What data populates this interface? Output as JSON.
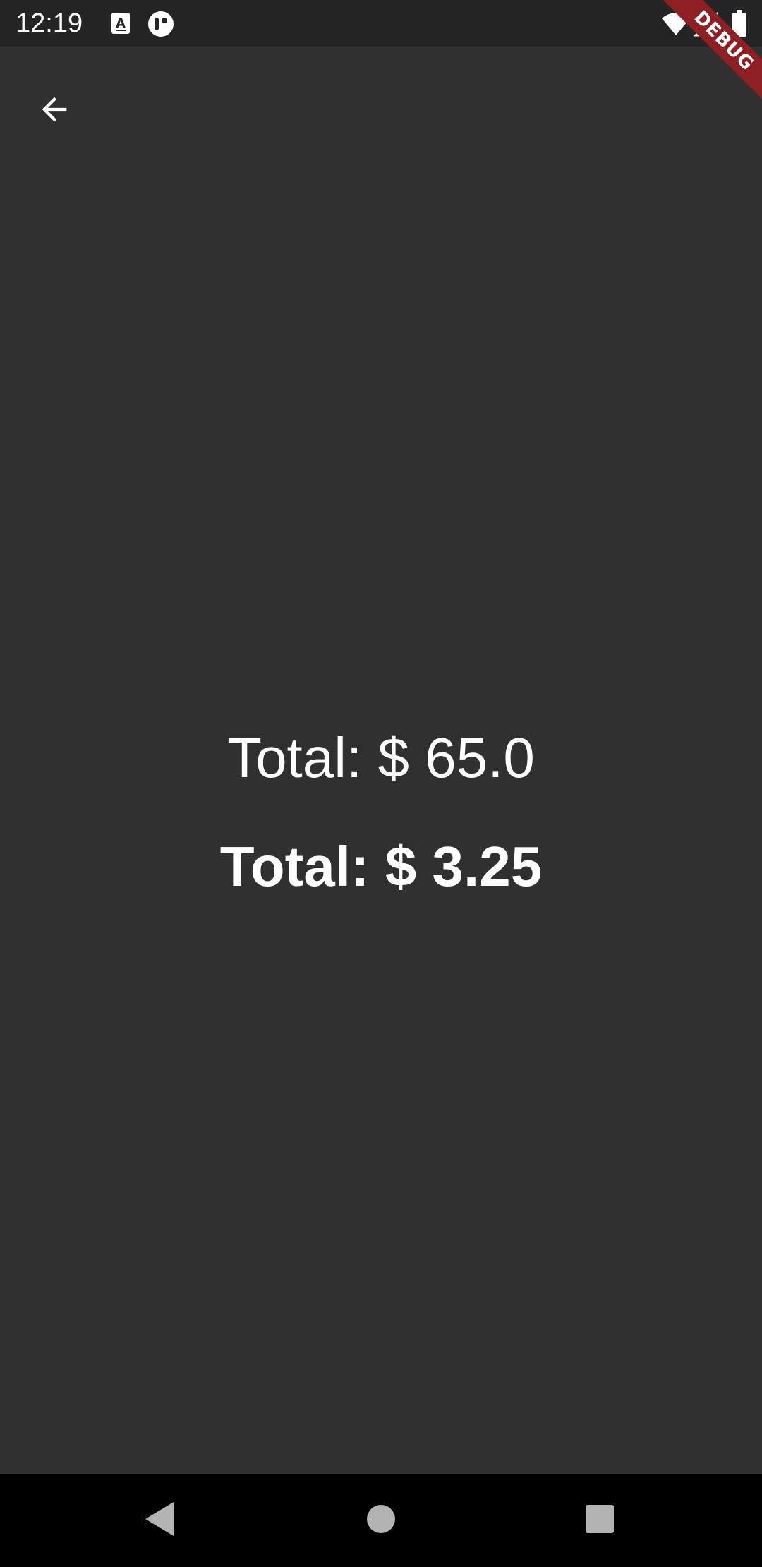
{
  "status_bar": {
    "time": "12:19",
    "icons": [
      "text-recognition-icon",
      "app-notification-icon",
      "wifi-icon",
      "cellular-signal-icon",
      "battery-icon"
    ]
  },
  "app_bar": {
    "back_icon": "arrow-back-icon"
  },
  "content": {
    "total_regular": "Total: $ 65.0",
    "total_bold": "Total: $ 3.25"
  },
  "debug_banner": {
    "label": "DEBUG",
    "color": "#8e1f24"
  },
  "nav_bar": {
    "buttons": [
      "back-triangle-icon",
      "home-circle-icon",
      "recents-square-icon"
    ]
  },
  "colors": {
    "background": "#303030",
    "status_bar": "#242424",
    "text": "#ffffff",
    "nav_bar": "#000000"
  }
}
